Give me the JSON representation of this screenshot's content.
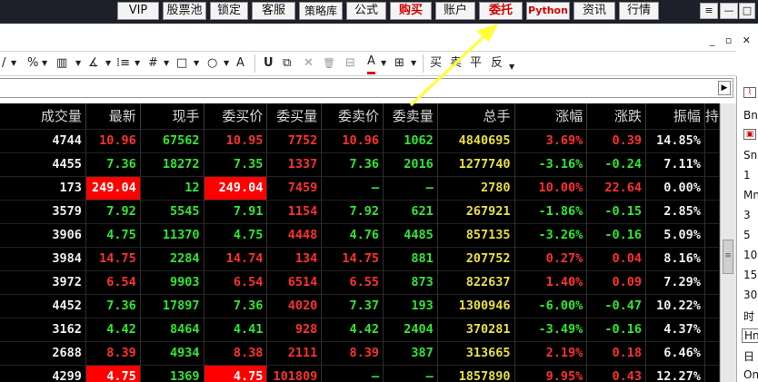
{
  "topbar": {
    "buttons": [
      {
        "label": "VIP",
        "style": "red"
      },
      {
        "label": "股票池",
        "style": "normal"
      },
      {
        "label": "锁定",
        "style": "normal"
      },
      {
        "label": "客服",
        "style": "normal"
      },
      {
        "label": "策略库",
        "style": "normal"
      },
      {
        "label": "公式",
        "style": "normal"
      },
      {
        "label": "购买",
        "style": "red"
      },
      {
        "label": "账户",
        "style": "normal"
      },
      {
        "label": "委托",
        "style": "red"
      },
      {
        "label": "Python",
        "style": "red"
      },
      {
        "label": "资讯",
        "style": "normal"
      },
      {
        "label": "行情",
        "style": "normal"
      }
    ],
    "window_controls": {
      "menu": "≡",
      "minimize": "—",
      "maximize": "□",
      "close": "✕"
    }
  },
  "subwindow_controls": "_ ▫ ✕",
  "toolbar": {
    "tools": [
      "/",
      "%",
      "▥",
      "∡",
      "⁞≡",
      "#",
      "□",
      "○",
      "A",
      "U",
      "⧉",
      "✕",
      "🗑",
      "⊟",
      "A",
      "⊞",
      "买",
      "卖",
      "平",
      "反"
    ]
  },
  "table": {
    "columns": [
      "成交量",
      "最新",
      "现手",
      "委买价",
      "委买量",
      "委卖价",
      "委卖量",
      "总手",
      "涨幅",
      "涨跌",
      "振幅",
      "持"
    ],
    "rows": [
      {
        "vol": "4744",
        "last": "10.96",
        "cur": "67562",
        "bid": "10.95",
        "bidv": "7752",
        "ask": "10.96",
        "askv": "1062",
        "total": "4840695",
        "pct": "3.69%",
        "chg": "0.39",
        "amp": "14.85%",
        "dir": "up",
        "hl": false
      },
      {
        "vol": "4455",
        "last": "7.36",
        "cur": "18272",
        "bid": "7.35",
        "bidv": "1337",
        "ask": "7.36",
        "askv": "2016",
        "total": "1277740",
        "pct": "-3.16%",
        "chg": "-0.24",
        "amp": "7.11%",
        "dir": "down",
        "hl": false
      },
      {
        "vol": "173",
        "last": "249.04",
        "cur": "12",
        "bid": "249.04",
        "bidv": "7459",
        "ask": "—",
        "askv": "—",
        "total": "2780",
        "pct": "10.00%",
        "chg": "22.64",
        "amp": "0.00%",
        "dir": "up",
        "hl": true
      },
      {
        "vol": "3579",
        "last": "7.92",
        "cur": "5545",
        "bid": "7.91",
        "bidv": "1154",
        "ask": "7.92",
        "askv": "621",
        "total": "267921",
        "pct": "-1.86%",
        "chg": "-0.15",
        "amp": "2.85%",
        "dir": "down",
        "hl": false
      },
      {
        "vol": "3906",
        "last": "4.75",
        "cur": "11370",
        "bid": "4.75",
        "bidv": "4448",
        "ask": "4.76",
        "askv": "4485",
        "total": "857135",
        "pct": "-3.26%",
        "chg": "-0.16",
        "amp": "5.09%",
        "dir": "down",
        "hl": false
      },
      {
        "vol": "3984",
        "last": "14.75",
        "cur": "2284",
        "bid": "14.74",
        "bidv": "134",
        "ask": "14.75",
        "askv": "881",
        "total": "207752",
        "pct": "0.27%",
        "chg": "0.04",
        "amp": "8.16%",
        "dir": "up",
        "hl": false
      },
      {
        "vol": "3972",
        "last": "6.54",
        "cur": "9903",
        "bid": "6.54",
        "bidv": "6514",
        "ask": "6.55",
        "askv": "873",
        "total": "822637",
        "pct": "1.40%",
        "chg": "0.09",
        "amp": "7.29%",
        "dir": "up",
        "hl": false
      },
      {
        "vol": "4452",
        "last": "7.36",
        "cur": "17897",
        "bid": "7.36",
        "bidv": "4020",
        "ask": "7.37",
        "askv": "193",
        "total": "1300946",
        "pct": "-6.00%",
        "chg": "-0.47",
        "amp": "10.22%",
        "dir": "down",
        "hl": false
      },
      {
        "vol": "3162",
        "last": "4.42",
        "cur": "8464",
        "bid": "4.41",
        "bidv": "928",
        "ask": "4.42",
        "askv": "2404",
        "total": "370281",
        "pct": "-3.49%",
        "chg": "-0.16",
        "amp": "4.37%",
        "dir": "down",
        "hl": false
      },
      {
        "vol": "2688",
        "last": "8.39",
        "cur": "4934",
        "bid": "8.38",
        "bidv": "2111",
        "ask": "8.39",
        "askv": "387",
        "total": "313665",
        "pct": "2.19%",
        "chg": "0.18",
        "amp": "6.46%",
        "dir": "up",
        "hl": false
      },
      {
        "vol": "4299",
        "last": "4.75",
        "cur": "1369",
        "bid": "4.75",
        "bidv": "101809",
        "ask": "—",
        "askv": "—",
        "total": "1857890",
        "pct": "9.95%",
        "chg": "0.43",
        "amp": "12.27%",
        "dir": "up",
        "hl": true
      }
    ]
  },
  "right_panel": {
    "items": [
      "Bn",
      "Sn",
      "1",
      "Mn",
      "3",
      "5",
      "10",
      "15",
      "30",
      "时",
      "Hn",
      "日",
      "On"
    ]
  },
  "colors": {
    "up": "#ff3030",
    "down": "#30e830",
    "neutral": "#f0f0f0",
    "total": "#e8e040",
    "highlight": "#ff0000",
    "arrow": "#ffff33"
  }
}
